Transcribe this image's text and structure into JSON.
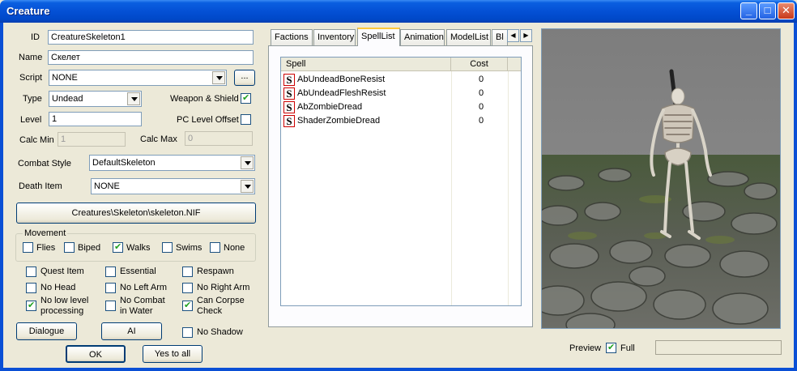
{
  "window": {
    "title": "Creature",
    "minimize_glyph": "_",
    "maximize_glyph": "□",
    "close_glyph": "✕"
  },
  "fields": {
    "id_label": "ID",
    "id_value": "CreatureSkeleton1",
    "name_label": "Name",
    "name_value": "Скелет",
    "script_label": "Script",
    "script_value": "NONE",
    "script_browse": "...",
    "type_label": "Type",
    "type_value": "Undead",
    "weapon_shield_label": "Weapon & Shield",
    "weapon_shield_checked": true,
    "level_label": "Level",
    "level_value": "1",
    "pc_level_offset_label": "PC Level Offset",
    "pc_level_offset_checked": false,
    "calc_min_label": "Calc Min",
    "calc_min_value": "1",
    "calc_max_label": "Calc Max",
    "calc_max_value": "0",
    "combat_style_label": "Combat Style",
    "combat_style_value": "DefaultSkeleton",
    "death_item_label": "Death Item",
    "death_item_value": "NONE",
    "model_path": "Creatures\\Skeleton\\skeleton.NIF"
  },
  "movement": {
    "title": "Movement",
    "options": [
      {
        "label": "Flies",
        "checked": false
      },
      {
        "label": "Biped",
        "checked": false
      },
      {
        "label": "Walks",
        "checked": true
      },
      {
        "label": "Swims",
        "checked": false
      },
      {
        "label": "None",
        "checked": false
      }
    ]
  },
  "flags": [
    {
      "label": "Quest Item",
      "checked": false
    },
    {
      "label": "Essential",
      "checked": false
    },
    {
      "label": "Respawn",
      "checked": false
    },
    {
      "label": "No Head",
      "checked": false
    },
    {
      "label": "No Left Arm",
      "checked": false
    },
    {
      "label": "No Right Arm",
      "checked": false
    },
    {
      "label": "No low level processing",
      "line1": "No low level",
      "line2": "processing",
      "checked": true
    },
    {
      "label": "No Combat in Water",
      "line1": "No Combat",
      "line2": "in Water",
      "checked": false
    },
    {
      "label": "Can Corpse Check",
      "line1": "Can Corpse",
      "line2": "Check",
      "checked": true
    },
    {
      "label": "No Shadow",
      "checked": false
    }
  ],
  "buttons": {
    "dialogue": "Dialogue",
    "ai": "AI",
    "ok": "OK",
    "yes_to_all": "Yes to all"
  },
  "tabs": [
    {
      "label": "Factions",
      "active": false
    },
    {
      "label": "Inventory",
      "active": false
    },
    {
      "label": "SpellList",
      "active": true
    },
    {
      "label": "Animation",
      "active": false
    },
    {
      "label": "ModelList",
      "active": false
    },
    {
      "label": "Bl",
      "active": false
    }
  ],
  "tab_scroll": {
    "left": "◀",
    "right": "▶"
  },
  "spell_list": {
    "columns": [
      "Spell",
      "Cost"
    ],
    "icon_letter": "S",
    "rows": [
      {
        "name": "AbUndeadBoneResist",
        "cost": "0"
      },
      {
        "name": "AbUndeadFleshResist",
        "cost": "0"
      },
      {
        "name": "AbZombieDread",
        "cost": "0"
      },
      {
        "name": "ShaderZombieDread",
        "cost": "0"
      }
    ]
  },
  "preview": {
    "label": "Preview",
    "full_label": "Full",
    "full_checked": true
  },
  "colors": {
    "titlebar": "#0450d5",
    "dialog_bg": "#ece9d8",
    "icon_border": "#cc0000"
  }
}
